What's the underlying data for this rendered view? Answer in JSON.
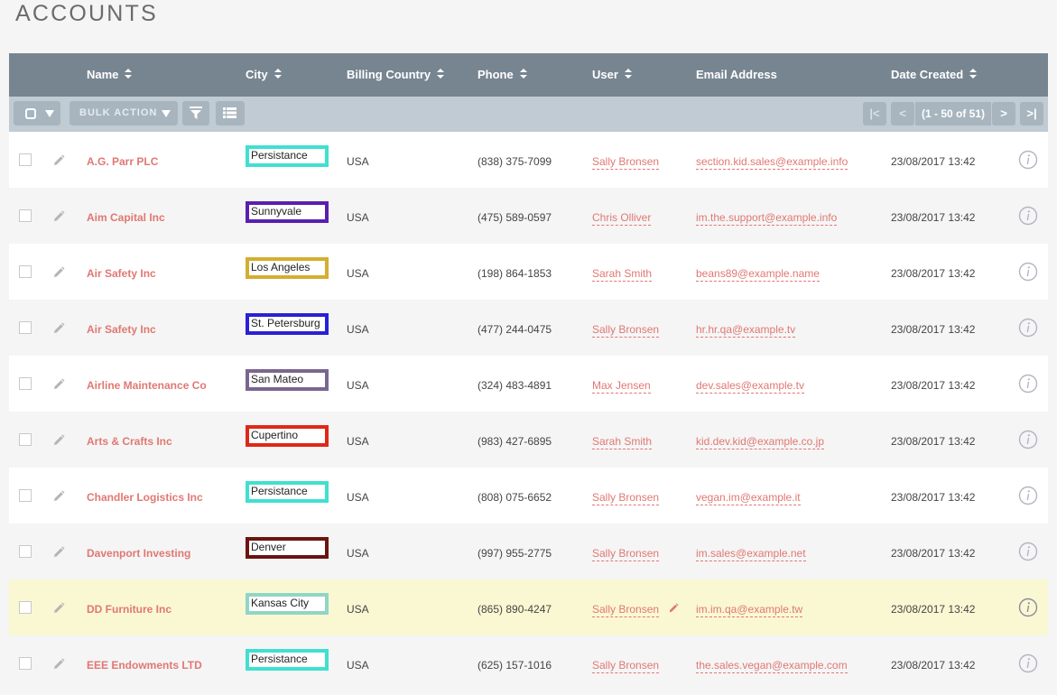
{
  "page": {
    "title": "ACCOUNTS"
  },
  "columns": {
    "name": "Name",
    "city": "City",
    "billing_country": "Billing Country",
    "phone": "Phone",
    "user": "User",
    "email": "Email Address",
    "date_created": "Date Created"
  },
  "toolbar": {
    "bulk_action": "BULK ACTION",
    "pagination": {
      "first": "|<",
      "prev": "<",
      "count": "(1 - 50 of 51)",
      "next": ">",
      "last": ">|"
    }
  },
  "icons": {
    "select_all": "checkbox-dropdown-icon",
    "filter": "filter-icon",
    "columns": "columns-list-icon",
    "edit": "pencil-icon",
    "info": "info-icon",
    "inline_edit": "pencil-icon"
  },
  "colors": {
    "header_bg": "#778591",
    "toolbar_bg": "#c0cbd4",
    "link": "#e07873",
    "highlight_row": "#faf8d2"
  },
  "rows": [
    {
      "name": "A.G. Parr PLC",
      "city": "Persistance",
      "city_color": "#40e0d0",
      "country": "USA",
      "phone": "(838) 375-7099",
      "user": "Sally Bronsen",
      "email": "section.kid.sales@example.info",
      "date": "23/08/2017 13:42"
    },
    {
      "name": "Aim Capital Inc",
      "city": "Sunnyvale",
      "city_color": "#5a1fb0",
      "country": "USA",
      "phone": "(475) 589-0597",
      "user": "Chris Olliver",
      "email": "im.the.support@example.info",
      "date": "23/08/2017 13:42"
    },
    {
      "name": "Air Safety Inc",
      "city": "Los Angeles",
      "city_color": "#d4ae30",
      "country": "USA",
      "phone": "(198) 864-1853",
      "user": "Sarah Smith",
      "email": "beans89@example.name",
      "date": "23/08/2017 13:42"
    },
    {
      "name": "Air Safety Inc",
      "city": "St. Petersburg",
      "city_color": "#2a20d6",
      "country": "USA",
      "phone": "(477) 244-0475",
      "user": "Sally Bronsen",
      "email": "hr.hr.qa@example.tv",
      "date": "23/08/2017 13:42"
    },
    {
      "name": "Airline Maintenance Co",
      "city": "San Mateo",
      "city_color": "#7a6790",
      "country": "USA",
      "phone": "(324) 483-4891",
      "user": "Max Jensen",
      "email": "dev.sales@example.tv",
      "date": "23/08/2017 13:42"
    },
    {
      "name": "Arts & Crafts Inc",
      "city": "Cupertino",
      "city_color": "#e02818",
      "country": "USA",
      "phone": "(983) 427-6895",
      "user": "Sarah Smith",
      "email": "kid.dev.kid@example.co.jp",
      "date": "23/08/2017 13:42"
    },
    {
      "name": "Chandler Logistics Inc",
      "city": "Persistance",
      "city_color": "#40e0d0",
      "country": "USA",
      "phone": "(808) 075-6652",
      "user": "Sally Bronsen",
      "email": "vegan.im@example.it",
      "date": "23/08/2017 13:42"
    },
    {
      "name": "Davenport Investing",
      "city": "Denver",
      "city_color": "#6b1410",
      "country": "USA",
      "phone": "(997) 955-2775",
      "user": "Sally Bronsen",
      "email": "im.sales@example.net",
      "date": "23/08/2017 13:42"
    },
    {
      "name": "DD Furniture Inc",
      "city": "Kansas City",
      "city_color": "#8fd6c6",
      "country": "USA",
      "phone": "(865) 890-4247",
      "user": "Sally Bronsen",
      "email": "im.im.qa@example.tw",
      "date": "23/08/2017 13:42"
    },
    {
      "name": "EEE Endowments LTD",
      "city": "Persistance",
      "city_color": "#40e0d0",
      "country": "USA",
      "phone": "(625) 157-1016",
      "user": "Sally Bronsen",
      "email": "the.sales.vegan@example.com",
      "date": "23/08/2017 13:42"
    }
  ]
}
